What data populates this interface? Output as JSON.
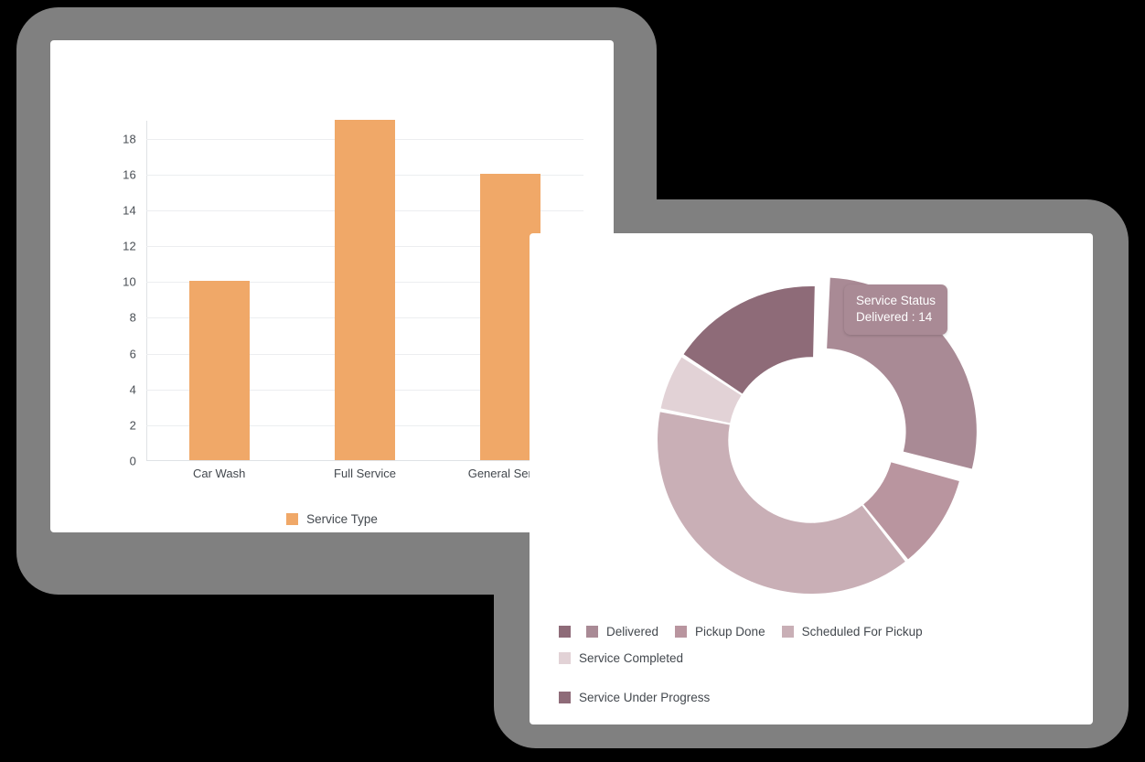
{
  "page": {
    "background": "#000000",
    "backdrop_color": "#808080",
    "card_color": "#ffffff"
  },
  "bar_card": {
    "name": "service-type-bar-card",
    "legend": {
      "label": "Service Type",
      "color": "#F0A868"
    }
  },
  "donut_card": {
    "name": "service-status-donut-card",
    "tooltip": {
      "title": "Service Status",
      "value": "Delivered : 14",
      "background": "#A98A95"
    },
    "orphan_swatch_color": "#8E6B78",
    "legend_items": [
      {
        "label": "Delivered",
        "color": "#A98A95"
      },
      {
        "label": "Pickup Done",
        "color": "#B9959F"
      },
      {
        "label": "Scheduled For Pickup",
        "color": "#C9AFB6"
      },
      {
        "label": "Service Completed",
        "color": "#E2D2D6"
      },
      {
        "label": "Service Under Progress",
        "color": "#8E6B78"
      }
    ]
  },
  "chart_data": [
    {
      "type": "bar",
      "name": "service-type-distribution",
      "title": "",
      "xlabel": "",
      "ylabel": "",
      "categories": [
        "Car Wash",
        "Full Service",
        "General Service"
      ],
      "values": [
        10,
        19,
        16
      ],
      "series": [
        {
          "name": "Service Type",
          "color": "#F0A868",
          "values": [
            10,
            19,
            16
          ]
        }
      ],
      "ylim": [
        0,
        19
      ],
      "yticks": [
        0,
        2,
        4,
        6,
        8,
        10,
        12,
        14,
        16,
        18
      ],
      "grid": true,
      "legend": [
        "Service Type"
      ],
      "legend_position": "bottom"
    },
    {
      "type": "pie",
      "variant": "donut",
      "name": "service-status-distribution",
      "title": "Service Status",
      "labels": [
        "Delivered",
        "Pickup Done",
        "Scheduled For Pickup",
        "Service Completed",
        "Service Under Progress"
      ],
      "values": [
        14,
        5,
        19,
        3,
        8
      ],
      "colors": [
        "#A98A95",
        "#B9959F",
        "#C9AFB6",
        "#E2D2D6",
        "#8E6B78"
      ],
      "exploded": [
        "Delivered"
      ],
      "start_angle_deg": 2,
      "inner_radius_ratio": 0.54,
      "legend_position": "bottom",
      "annotations": [
        "Service Status",
        "Delivered : 14"
      ]
    }
  ]
}
